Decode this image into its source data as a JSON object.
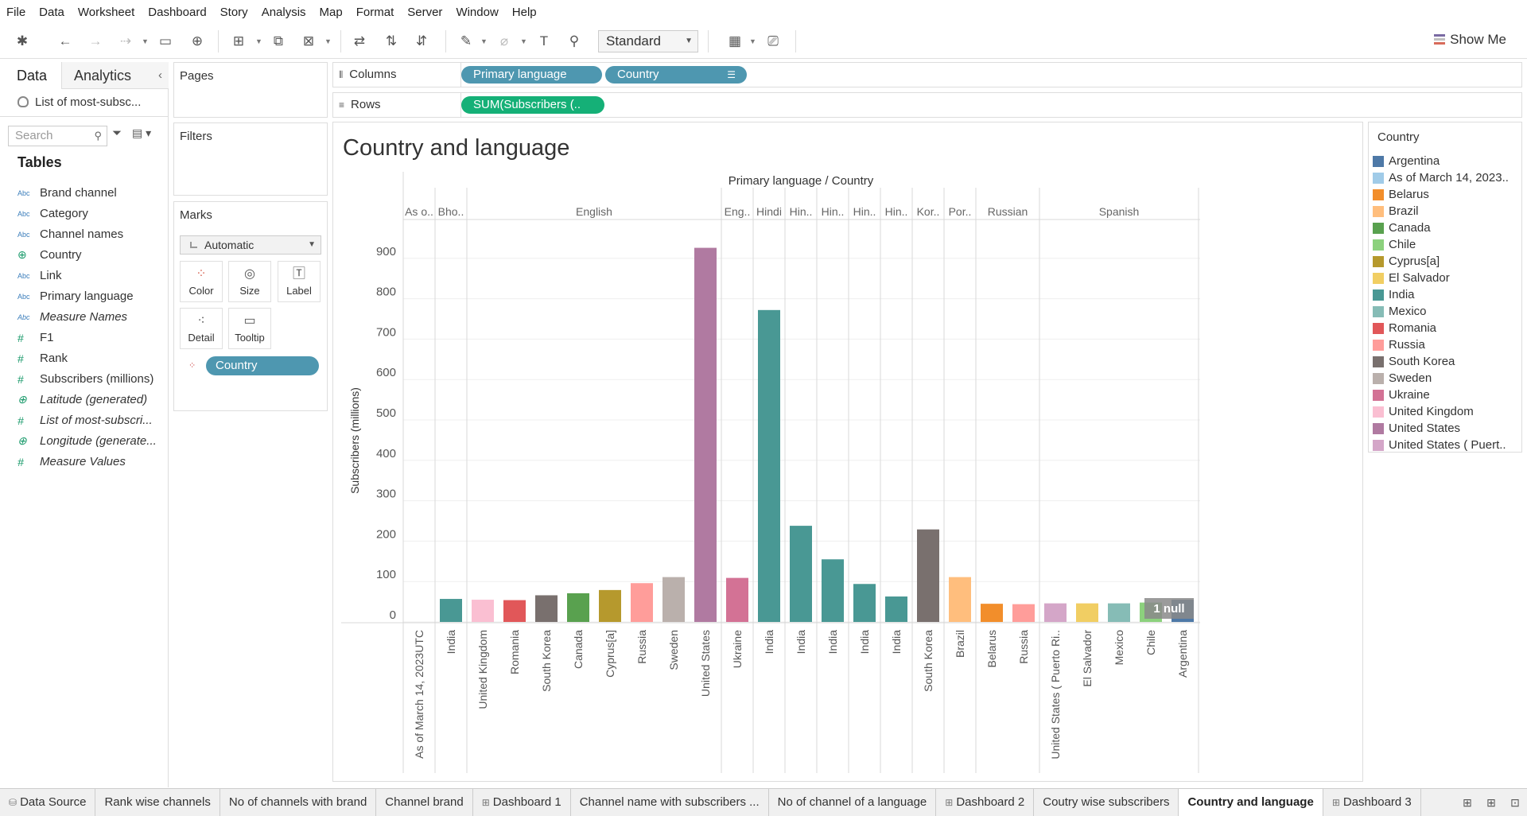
{
  "menu": [
    "File",
    "Data",
    "Worksheet",
    "Dashboard",
    "Story",
    "Analysis",
    "Map",
    "Format",
    "Server",
    "Window",
    "Help"
  ],
  "toolbar": {
    "fit_select": "Standard",
    "show_me": "Show Me"
  },
  "left_pane": {
    "tab_data": "Data",
    "tab_analytics": "Analytics",
    "datasource": "List of most-subsc...",
    "search_placeholder": "Search",
    "tables_heading": "Tables",
    "fields": [
      {
        "name": "Brand channel",
        "type": "abc",
        "italic": false
      },
      {
        "name": "Category",
        "type": "abc",
        "italic": false
      },
      {
        "name": "Channel names",
        "type": "abc",
        "italic": false
      },
      {
        "name": "Country",
        "type": "geo",
        "italic": false
      },
      {
        "name": "Link",
        "type": "abc",
        "italic": false
      },
      {
        "name": "Primary language",
        "type": "abc",
        "italic": false
      },
      {
        "name": "Measure Names",
        "type": "abc",
        "italic": true
      },
      {
        "name": "F1",
        "type": "num",
        "italic": false
      },
      {
        "name": "Rank",
        "type": "num",
        "italic": false
      },
      {
        "name": "Subscribers (millions)",
        "type": "num",
        "italic": false
      },
      {
        "name": "Latitude (generated)",
        "type": "geo",
        "italic": true
      },
      {
        "name": "List of most-subscri...",
        "type": "num",
        "italic": true
      },
      {
        "name": "Longitude (generate...",
        "type": "geo",
        "italic": true
      },
      {
        "name": "Measure Values",
        "type": "num",
        "italic": true
      }
    ]
  },
  "cards": {
    "pages": "Pages",
    "filters": "Filters",
    "marks": "Marks",
    "mark_type": "Automatic",
    "buttons": {
      "color": "Color",
      "size": "Size",
      "label": "Label",
      "detail": "Detail",
      "tooltip": "Tooltip"
    },
    "color_pill": "Country"
  },
  "shelves": {
    "columns_label": "Columns",
    "rows_label": "Rows",
    "columns_pills": [
      "Primary language",
      "Country"
    ],
    "rows_pill": "SUM(Subscribers (.."
  },
  "sheet_title": "Country and language",
  "legend": {
    "title": "Country",
    "items": [
      {
        "label": "Argentina",
        "color": "#4e79a7"
      },
      {
        "label": "As of March 14, 2023..",
        "color": "#a0cbe8"
      },
      {
        "label": "Belarus",
        "color": "#f28e2b"
      },
      {
        "label": "Brazil",
        "color": "#ffbe7d"
      },
      {
        "label": "Canada",
        "color": "#59a14f"
      },
      {
        "label": "Chile",
        "color": "#8cd17d"
      },
      {
        "label": "Cyprus[a]",
        "color": "#b6992d"
      },
      {
        "label": "El Salvador",
        "color": "#f1ce63"
      },
      {
        "label": "India",
        "color": "#499894"
      },
      {
        "label": "Mexico",
        "color": "#86bcb6"
      },
      {
        "label": "Romania",
        "color": "#e15759"
      },
      {
        "label": "Russia",
        "color": "#ff9d9a"
      },
      {
        "label": "South Korea",
        "color": "#79706e"
      },
      {
        "label": "Sweden",
        "color": "#bab0ac"
      },
      {
        "label": "Ukraine",
        "color": "#d37295"
      },
      {
        "label": "United Kingdom",
        "color": "#fabfd2"
      },
      {
        "label": "United States",
        "color": "#b07aa1"
      },
      {
        "label": "United States ( Puert..",
        "color": "#d4a6c8"
      }
    ]
  },
  "chart_data": {
    "type": "bar",
    "header": "Primary language / Country",
    "ylabel": "Subscribers (millions)",
    "ylim": [
      0,
      1000
    ],
    "yticks": [
      0,
      100,
      200,
      300,
      400,
      500,
      600,
      700,
      800,
      900
    ],
    "null_indicator": "1 null",
    "groups": [
      {
        "label": "As o..",
        "bars": [
          {
            "country": "As of March 14, 2023UTC",
            "value": null
          }
        ]
      },
      {
        "label": "Bho..",
        "bars": [
          {
            "country": "India",
            "value": 57
          }
        ]
      },
      {
        "label": "English",
        "bars": [
          {
            "country": "United Kingdom",
            "value": 55
          },
          {
            "country": "Romania",
            "value": 54
          },
          {
            "country": "South Korea",
            "value": 66
          },
          {
            "country": "Canada",
            "value": 71
          },
          {
            "country": "Cyprus[a]",
            "value": 79
          },
          {
            "country": "Russia",
            "value": 96
          },
          {
            "country": "Sweden",
            "value": 111
          },
          {
            "country": "United States",
            "value": 926
          }
        ]
      },
      {
        "label": "Eng..",
        "bars": [
          {
            "country": "Ukraine",
            "value": 109
          }
        ]
      },
      {
        "label": "Hindi",
        "bars": [
          {
            "country": "India",
            "value": 772
          }
        ]
      },
      {
        "label": "Hin..",
        "bars": [
          {
            "country": "India",
            "value": 238
          }
        ]
      },
      {
        "label": "Hin..",
        "bars": [
          {
            "country": "India",
            "value": 155
          }
        ]
      },
      {
        "label": "Hin..",
        "bars": [
          {
            "country": "India",
            "value": 94
          }
        ]
      },
      {
        "label": "Hin..",
        "bars": [
          {
            "country": "India",
            "value": 63
          }
        ]
      },
      {
        "label": "Kor..",
        "bars": [
          {
            "country": "South Korea",
            "value": 229
          }
        ]
      },
      {
        "label": "Por..",
        "bars": [
          {
            "country": "Brazil",
            "value": 111
          }
        ]
      },
      {
        "label": "Russian",
        "bars": [
          {
            "country": "Belarus",
            "value": 45
          },
          {
            "country": "Russia",
            "value": 44
          }
        ]
      },
      {
        "label": "Spanish",
        "bars": [
          {
            "country": "United States ( Puerto Ri..",
            "value": 46
          },
          {
            "country": "El Salvador",
            "value": 46
          },
          {
            "country": "Mexico",
            "value": 46
          },
          {
            "country": "Chile",
            "value": 48
          },
          {
            "country": "Argentina",
            "value": 55
          }
        ]
      }
    ]
  },
  "bottom_tabs": [
    {
      "label": "Data Source",
      "icon": "database-icon",
      "active": false
    },
    {
      "label": "Rank wise channels",
      "icon": "",
      "active": false
    },
    {
      "label": "No of channels with brand",
      "icon": "",
      "active": false
    },
    {
      "label": "Channel brand",
      "icon": "",
      "active": false
    },
    {
      "label": "Dashboard 1",
      "icon": "dashboard-icon",
      "active": false
    },
    {
      "label": "Channel name with subscribers ...",
      "icon": "",
      "active": false
    },
    {
      "label": "No of channel of a language",
      "icon": "",
      "active": false
    },
    {
      "label": "Dashboard 2",
      "icon": "dashboard-icon",
      "active": false
    },
    {
      "label": "Coutry wise subscribers",
      "icon": "",
      "active": false
    },
    {
      "label": "Country and language",
      "icon": "",
      "active": true
    },
    {
      "label": "Dashboard 3",
      "icon": "dashboard-icon",
      "active": false
    }
  ]
}
